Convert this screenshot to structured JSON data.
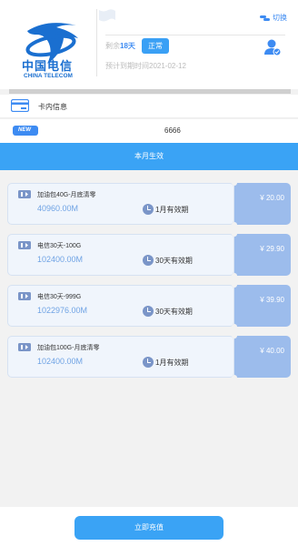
{
  "brand": {
    "name_cn": "中国电信",
    "name_en": "CHINA TELECOM",
    "color": "#1a6fd0"
  },
  "header": {
    "switch_label": "切换",
    "remain_prefix": "剩余",
    "remain_days": "18天",
    "status": "正常",
    "expire": "预计到期时间2021-02-12"
  },
  "card": {
    "label": "卡内信息",
    "new_badge": "NEW",
    "number": "6666"
  },
  "month_label": "本月生效",
  "packages": [
    {
      "name": "加油包40G-月底清零",
      "size": "40960.00M",
      "valid": "1月有效期",
      "price": "¥ 20.00"
    },
    {
      "name": "电信30天-100G",
      "size": "102400.00M",
      "valid": "30天有效期",
      "price": "¥ 29.90"
    },
    {
      "name": "电信30天-999G",
      "size": "1022976.00M",
      "valid": "30天有效期",
      "price": "¥ 39.90"
    },
    {
      "name": "加油包100G-月底清零",
      "size": "102400.00M",
      "valid": "1月有效期",
      "price": "¥ 40.00"
    }
  ],
  "footer": {
    "recharge_label": "立即充值"
  },
  "colors": {
    "accent": "#3aa3f5",
    "price_bg": "#9cbcec",
    "card_bg": "#f0f5fc"
  }
}
